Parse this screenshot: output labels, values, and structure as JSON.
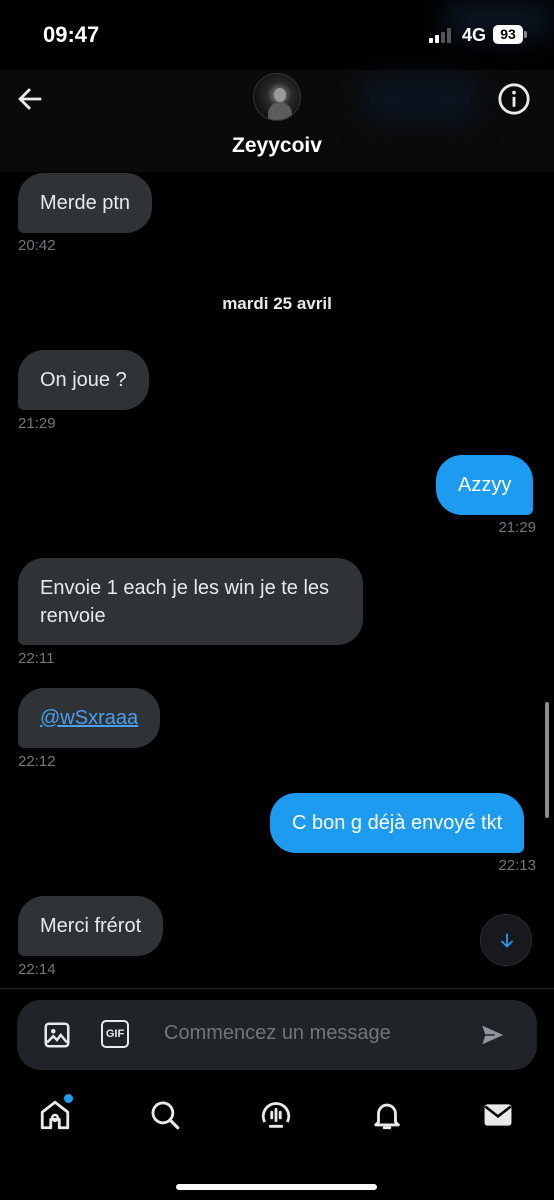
{
  "status_bar": {
    "time": "09:47",
    "network": "4G",
    "battery": "93"
  },
  "header": {
    "contact_name": "Zeyycoiv",
    "back_icon": "arrow-left-icon",
    "info_icon": "info-circle-icon"
  },
  "messages": [
    {
      "direction": "in",
      "text": "Merde ptn",
      "time": "20:42"
    },
    {
      "direction": "in",
      "text": "On joue ?",
      "time": "21:29"
    },
    {
      "direction": "out",
      "text": "Azzyy",
      "time": "21:29"
    },
    {
      "direction": "in",
      "text": "Envoie 1 each je les win je te les renvoie",
      "time": "22:11"
    },
    {
      "direction": "in",
      "text": "@wSxraaa",
      "time": "22:12",
      "is_mention": true
    },
    {
      "direction": "out",
      "text": "C bon g déjà envoyé tkt",
      "time": "22:13"
    },
    {
      "direction": "in",
      "text": "Merci frérot",
      "time": "22:14"
    }
  ],
  "date_separator": "mardi 25 avril",
  "composer": {
    "placeholder": "Commencez un message",
    "image_icon": "image-icon",
    "gif_label": "GIF",
    "send_icon": "send-icon"
  },
  "nav": {
    "items": [
      "home-icon",
      "search-icon",
      "spaces-icon",
      "notifications-icon",
      "messages-icon"
    ],
    "home_has_dot": true
  },
  "colors": {
    "accent": "#1d9bf0",
    "incoming_bubble": "#2f3336",
    "muted_text": "#71767b"
  }
}
